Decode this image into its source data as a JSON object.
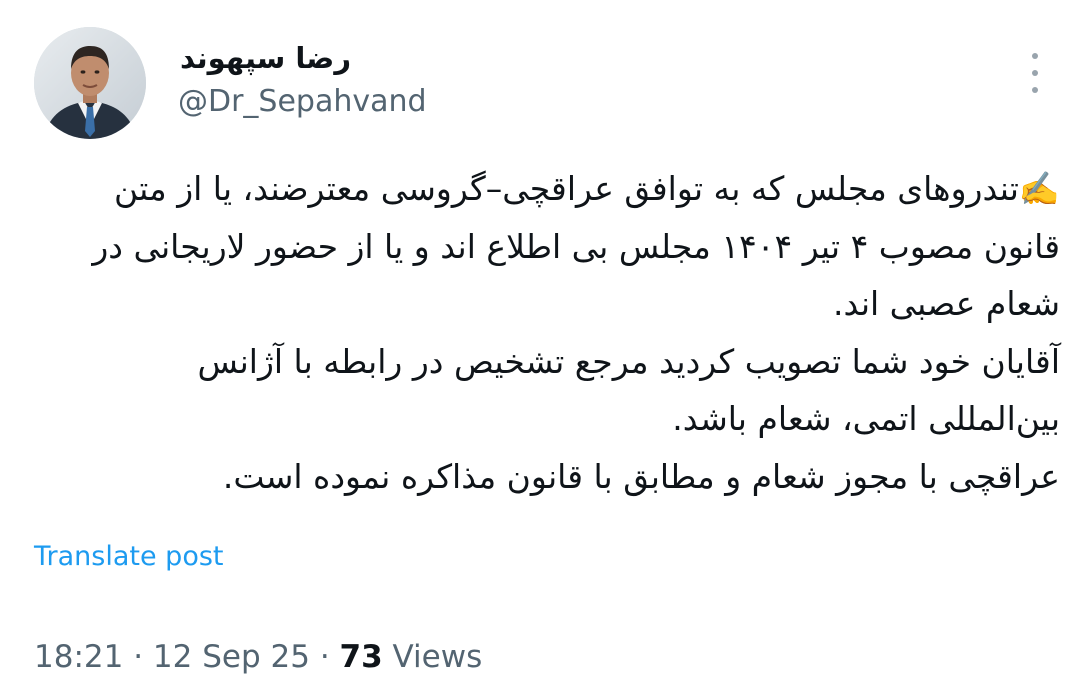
{
  "author": {
    "display_name": "رضا سپهوند",
    "handle": "@Dr_Sepahvand",
    "avatar_icon": "profile-photo"
  },
  "post": {
    "lines": [
      "✍️تندروهای مجلس که به توافق عراقچی–گروسی معترضند، یا از متن",
      "قانون مصوب ۴ تیر ۱۴۰۴ مجلس بی اطلاع اند و یا از حضور لاریجانی در",
      "شعام عصبی اند.",
      "آقایان خود شما تصویب کردید مرجع تشخیص در  رابطه با آژانس",
      "بین‌المللی اتمی، شعام باشد.",
      "عراقچی با مجوز شعام و مطابق با قانون مذاکره نموده است."
    ]
  },
  "actions": {
    "translate_label": "Translate post",
    "more_icon": "more-vertical-icon"
  },
  "meta": {
    "time": "18:21",
    "separator": "·",
    "date": "12 Sep 25",
    "views_count": "73",
    "views_label": "Views"
  },
  "colors": {
    "text": "#0f1419",
    "secondary": "#536471",
    "link": "#1d9bf0",
    "background": "#ffffff"
  }
}
